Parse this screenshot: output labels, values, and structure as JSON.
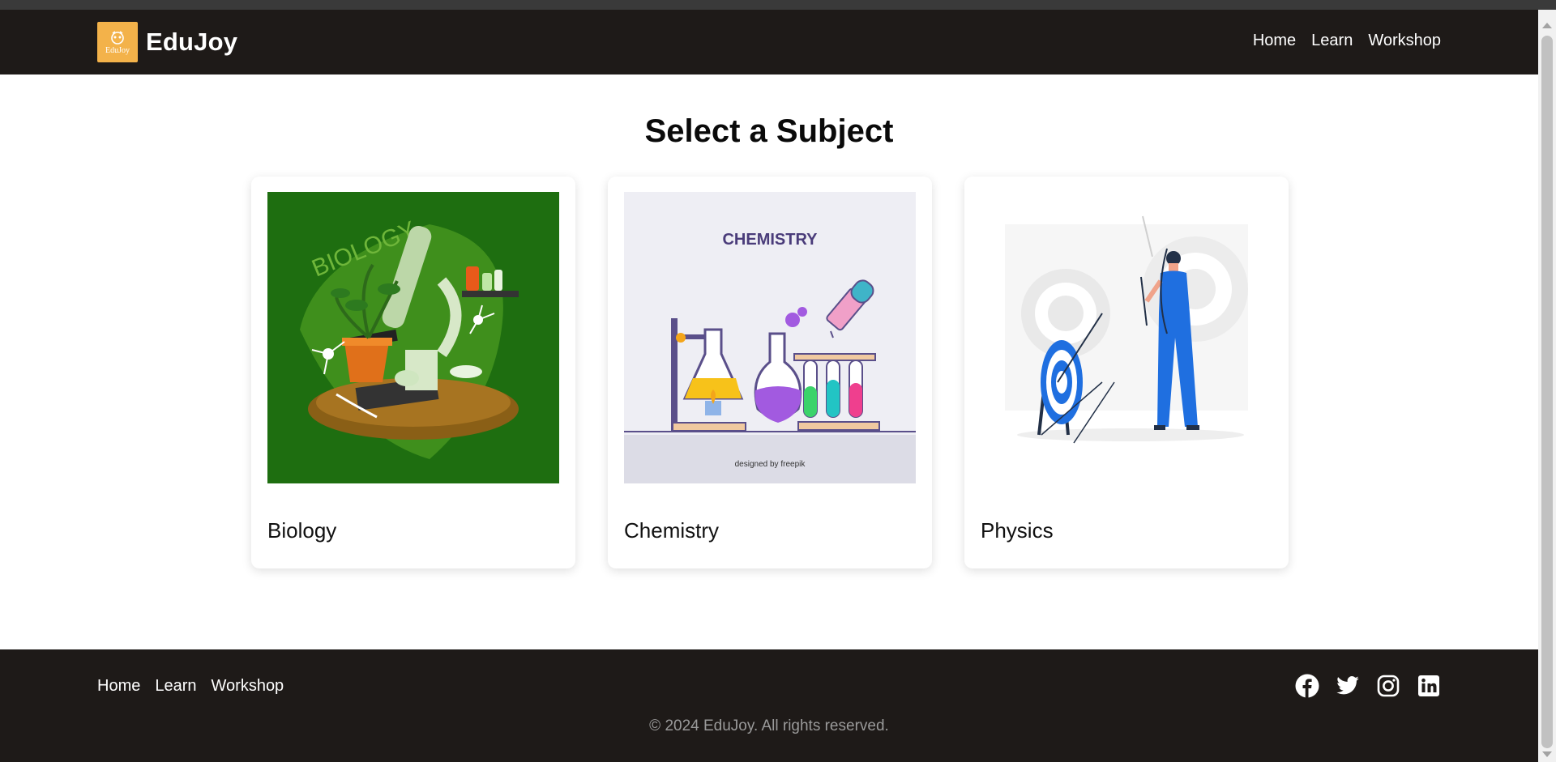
{
  "header": {
    "logo_text": "EduJoy",
    "brand": "EduJoy",
    "nav": [
      "Home",
      "Learn",
      "Workshop"
    ]
  },
  "main": {
    "title": "Select a Subject",
    "cards": [
      {
        "label": "Biology",
        "image_label": "BIOLOGY"
      },
      {
        "label": "Chemistry",
        "image_label": "CHEMISTRY",
        "image_credit": "designed by freepik"
      },
      {
        "label": "Physics"
      }
    ]
  },
  "footer": {
    "links": [
      "Home",
      "Learn",
      "Workshop"
    ],
    "social": [
      "facebook-icon",
      "twitter-icon",
      "instagram-icon",
      "linkedin-icon"
    ],
    "copyright": "© 2024 EduJoy. All rights reserved."
  },
  "colors": {
    "navbar": "#1e1a18",
    "logo_bg": "#f3b24a",
    "physics_blue": "#1f6fe0"
  }
}
